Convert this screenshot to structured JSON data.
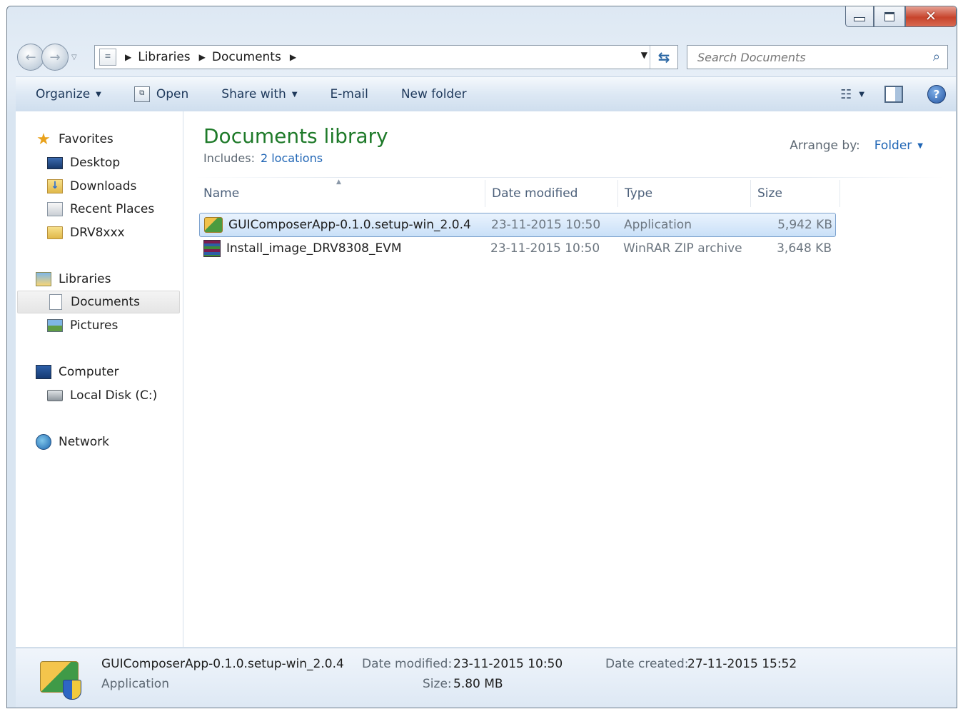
{
  "address": {
    "crumbs": [
      "Libraries",
      "Documents"
    ]
  },
  "search": {
    "placeholder": "Search Documents"
  },
  "toolbar": {
    "organize": "Organize",
    "open": "Open",
    "share_with": "Share with",
    "email": "E-mail",
    "new_folder": "New folder"
  },
  "sidebar": {
    "favorites": "Favorites",
    "desktop": "Desktop",
    "downloads": "Downloads",
    "recent_places": "Recent Places",
    "drv8xxx": "DRV8xxx",
    "libraries": "Libraries",
    "documents": "Documents",
    "pictures": "Pictures",
    "computer": "Computer",
    "local_disk": "Local Disk (C:)",
    "network": "Network"
  },
  "library": {
    "title": "Documents library",
    "includes_label": "Includes:",
    "includes_link": "2 locations",
    "arrange_label": "Arrange by:",
    "arrange_value": "Folder"
  },
  "columns": {
    "name": "Name",
    "date": "Date modified",
    "type": "Type",
    "size": "Size"
  },
  "files": [
    {
      "name": "GUIComposerApp-0.1.0.setup-win_2.0.4",
      "date": "23-11-2015 10:50",
      "type": "Application",
      "size": "5,942 KB",
      "icon": "installer-icon",
      "selected": true
    },
    {
      "name": "Install_image_DRV8308_EVM",
      "date": "23-11-2015 10:50",
      "type": "WinRAR ZIP archive",
      "size": "3,648 KB",
      "icon": "winrar-icon",
      "selected": false
    }
  ],
  "details": {
    "name": "GUIComposerApp-0.1.0.setup-win_2.0.4",
    "type": "Application",
    "date_modified_label": "Date modified:",
    "date_modified": "23-11-2015 10:50",
    "date_created_label": "Date created:",
    "date_created": "27-11-2015 15:52",
    "size_label": "Size:",
    "size": "5.80 MB"
  }
}
